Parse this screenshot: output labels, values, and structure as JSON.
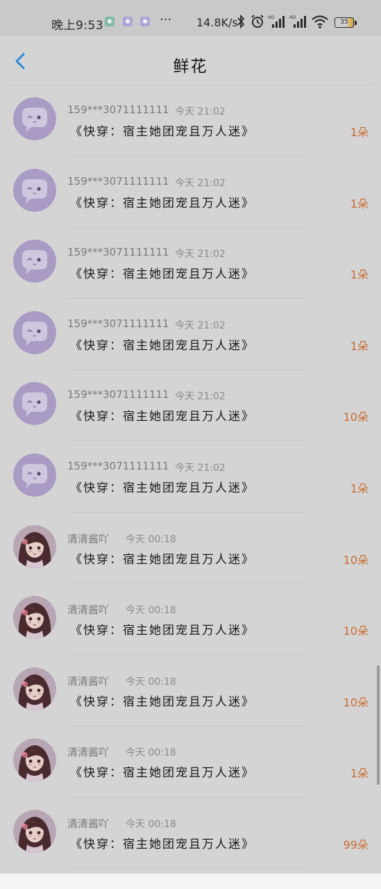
{
  "status_bar": {
    "time": "晚上9:53",
    "more": "···",
    "net_speed": "14.8K/s",
    "battery": "35"
  },
  "header": {
    "title": "鲜花"
  },
  "colors": {
    "count": "#c96a2e",
    "back": "#2b8ad8"
  },
  "items": [
    {
      "name": "159***3071111111",
      "time": "今天 21:02",
      "book": "《快穿：宿主她团宠且万人迷》",
      "count": "1朵",
      "avatar": "chat-bubble"
    },
    {
      "name": "159***3071111111",
      "time": "今天 21:02",
      "book": "《快穿：宿主她团宠且万人迷》",
      "count": "1朵",
      "avatar": "chat-bubble"
    },
    {
      "name": "159***3071111111",
      "time": "今天 21:02",
      "book": "《快穿：宿主她团宠且万人迷》",
      "count": "1朵",
      "avatar": "chat-bubble"
    },
    {
      "name": "159***3071111111",
      "time": "今天 21:02",
      "book": "《快穿：宿主她团宠且万人迷》",
      "count": "1朵",
      "avatar": "chat-bubble"
    },
    {
      "name": "159***3071111111",
      "time": "今天 21:02",
      "book": "《快穿：宿主她团宠且万人迷》",
      "count": "10朵",
      "avatar": "chat-bubble"
    },
    {
      "name": "159***3071111111",
      "time": "今天 21:02",
      "book": "《快穿：宿主她团宠且万人迷》",
      "count": "1朵",
      "avatar": "chat-bubble"
    },
    {
      "name": "清清酱吖",
      "time": "今天 00:18",
      "book": "《快穿：宿主她团宠且万人迷》",
      "count": "10朵",
      "avatar": "girl-portrait"
    },
    {
      "name": "清清酱吖",
      "time": "今天 00:18",
      "book": "《快穿：宿主她团宠且万人迷》",
      "count": "10朵",
      "avatar": "girl-portrait"
    },
    {
      "name": "清清酱吖",
      "time": "今天 00:18",
      "book": "《快穿：宿主她团宠且万人迷》",
      "count": "10朵",
      "avatar": "girl-portrait"
    },
    {
      "name": "清清酱吖",
      "time": "今天 00:18",
      "book": "《快穿：宿主她团宠且万人迷》",
      "count": "1朵",
      "avatar": "girl-portrait"
    },
    {
      "name": "清清酱吖",
      "time": "今天 00:18",
      "book": "《快穿：宿主她团宠且万人迷》",
      "count": "99朵",
      "avatar": "girl-portrait"
    }
  ]
}
